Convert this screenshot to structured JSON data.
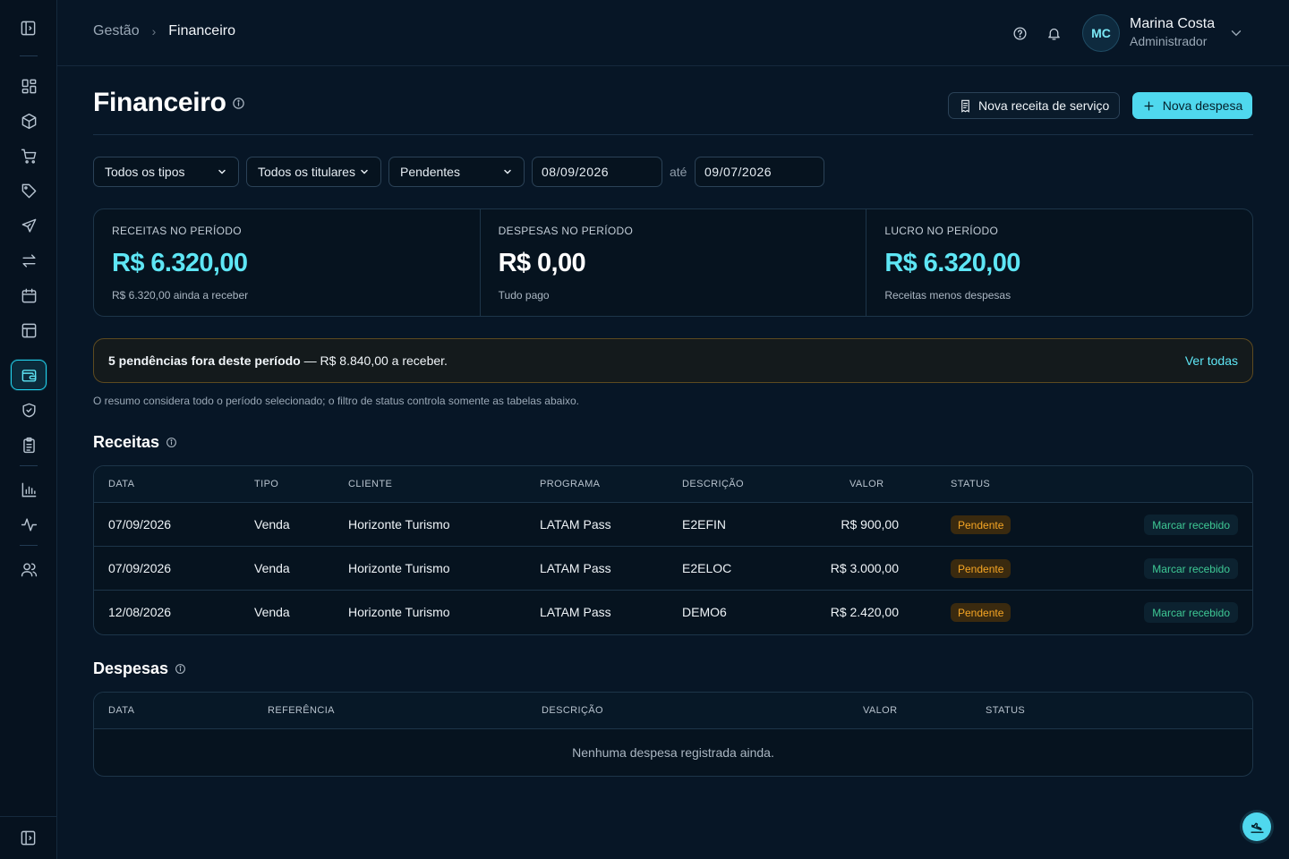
{
  "header": {
    "breadcrumb_root": "Gestão",
    "breadcrumb_sep": "›",
    "breadcrumb_current": "Financeiro",
    "user_initials": "MC",
    "user_name": "Marina Costa",
    "user_role": "Administrador"
  },
  "page": {
    "title": "Financeiro",
    "btn_new_receipt": "Nova receita de serviço",
    "btn_new_expense": "Nova despesa"
  },
  "filters": {
    "type": "Todos os tipos",
    "holder": "Todos os titulares",
    "status": "Pendentes",
    "date_from": "08/09/2026",
    "date_sep": "até",
    "date_to": "09/07/2026"
  },
  "stats": [
    {
      "label": "RECEITAS NO PERÍODO",
      "value": "R$ 6.320,00",
      "sub": "R$ 6.320,00 ainda a receber",
      "color": "#5ee6f5"
    },
    {
      "label": "DESPESAS NO PERÍODO",
      "value": "R$ 0,00",
      "sub": "Tudo pago",
      "color": "#ffffff"
    },
    {
      "label": "LUCRO NO PERÍODO",
      "value": "R$ 6.320,00",
      "sub": "Receitas menos despesas",
      "color": "#5ee6f5"
    }
  ],
  "alert": {
    "bold": "5 pendências fora deste período",
    "rest": " — R$ 8.840,00 a receber.",
    "link": "Ver todas"
  },
  "note": "O resumo considera todo o período selecionado; o filtro de status controla somente as tabelas abaixo.",
  "receitas": {
    "title": "Receitas",
    "headers": [
      "DATA",
      "TIPO",
      "CLIENTE",
      "PROGRAMA",
      "DESCRIÇÃO",
      "VALOR",
      "STATUS"
    ],
    "rows": [
      {
        "data": "07/09/2026",
        "tipo": "Venda",
        "cliente": "Horizonte Turismo",
        "programa": "LATAM Pass",
        "descricao": "E2EFIN",
        "valor": "R$ 900,00",
        "status": "Pendente",
        "action": "Marcar recebido"
      },
      {
        "data": "07/09/2026",
        "tipo": "Venda",
        "cliente": "Horizonte Turismo",
        "programa": "LATAM Pass",
        "descricao": "E2ELOC",
        "valor": "R$ 3.000,00",
        "status": "Pendente",
        "action": "Marcar recebido"
      },
      {
        "data": "12/08/2026",
        "tipo": "Venda",
        "cliente": "Horizonte Turismo",
        "programa": "LATAM Pass",
        "descricao": "DEMO6",
        "valor": "R$ 2.420,00",
        "status": "Pendente",
        "action": "Marcar recebido"
      }
    ]
  },
  "despesas": {
    "title": "Despesas",
    "headers": [
      "DATA",
      "REFERÊNCIA",
      "DESCRIÇÃO",
      "VALOR",
      "STATUS"
    ],
    "empty": "Nenhuma despesa registrada ainda."
  }
}
